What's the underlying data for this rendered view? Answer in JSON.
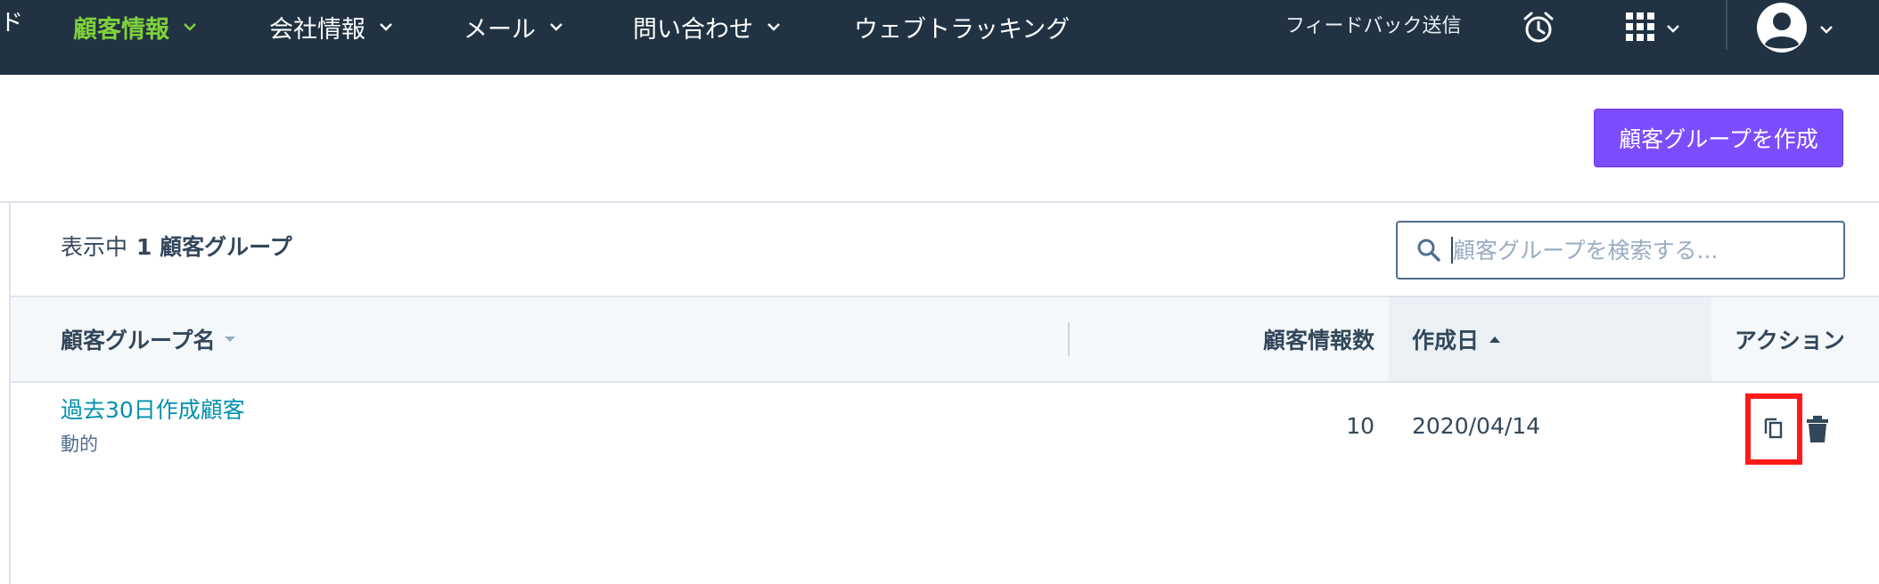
{
  "nav": {
    "left_fragment": "ド",
    "items": [
      {
        "label": "顧客情報",
        "active": true
      },
      {
        "label": "会社情報"
      },
      {
        "label": "メール"
      },
      {
        "label": "問い合わせ"
      },
      {
        "label": "ウェブトラッキング"
      }
    ],
    "feedback_label": "フィードバック送信",
    "icons": [
      "alarm-clock-icon",
      "apps-grid-icon",
      "avatar-icon"
    ],
    "active_color": "#7fd13b",
    "bg_color": "#213343"
  },
  "header": {
    "create_button_label": "顧客グループを作成",
    "accent_color": "#7c4dff"
  },
  "list": {
    "showing_prefix": "表示中",
    "showing_count_label": "1 顧客グループ",
    "search_placeholder": "顧客グループを検索する..."
  },
  "table": {
    "columns": [
      {
        "label": "顧客グループ名"
      },
      {
        "label": "顧客情報数"
      },
      {
        "label": "作成日",
        "sorted": "ascending"
      },
      {
        "label": "アクション"
      }
    ],
    "rows": [
      {
        "name": "過去30日作成顧客",
        "type": "動的",
        "count": "10",
        "created": "2020/04/14"
      }
    ]
  }
}
